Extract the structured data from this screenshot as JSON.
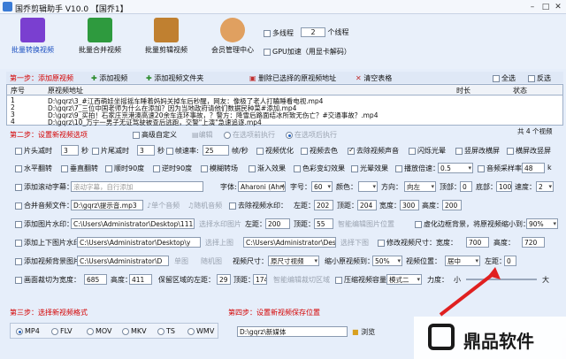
{
  "window": {
    "title": "国乔剪辑助手 V10.0  【国乔1】"
  },
  "toolbar": {
    "tools": [
      {
        "label": "批量转换视频"
      },
      {
        "label": "批量合并视频"
      },
      {
        "label": "批量剪辑视频"
      },
      {
        "label": "会员管理中心"
      }
    ],
    "multithread_label": "多线程",
    "thread_count": "2",
    "thread_suffix": "个线程",
    "gpu_label": "GPU加速（用显卡解码）"
  },
  "step1": {
    "title": "第一步：添加原视频",
    "add_video": "添加视频",
    "add_folder": "添加视频文件夹",
    "remove": "删除已选择的原视频地址",
    "clear": "清空表格",
    "select_all": "全选",
    "invert": "反选"
  },
  "list": {
    "headers": [
      "序号",
      "原视频地址",
      "时长",
      "状态"
    ],
    "rows": [
      {
        "no": "1",
        "path": "D:\\gqrz\\3_#江西萌娃坐摇摇车睡着妈妈关掉车后秒醒，网友：像极了老人打瞌睡看电视.mp4"
      },
      {
        "no": "2",
        "path": "D:\\gqrz\\7_三位中国老师为什么在添加？因为当地政府请他们数据民种菜#添加.mp4"
      },
      {
        "no": "3",
        "path": "D:\\gqrz\\9_买拍！石家庄京港澳高速20余车连环事故，？警方：降雪后路面结冰所致无伤亡？#交通事故？.mp4"
      },
      {
        "no": "4",
        "path": "D:\\gqrz\\10_万宁一男子无证驾驶被查后逃跑，交警\"上演\"急速追逐.mp4"
      }
    ],
    "count": "共 4 个视频"
  },
  "step2": {
    "title": "第二步：设置新视频选项",
    "advanced": "高级自定义",
    "edit": "编辑",
    "before": "在选项前执行",
    "after": "在选项后执行",
    "r1": {
      "head_cut": "片头减时",
      "head_val": "3",
      "sec1": "秒",
      "tail_cut": "片尾减时",
      "tail_val": "3",
      "sec2": "秒",
      "fps": "帧速率:",
      "fps_val": "25",
      "fps_unit": "帧/秒",
      "optimize": "视频优化",
      "decolor": "视频去色",
      "remove_audio": "去除视频声音",
      "flash": "闪烁光晕",
      "v_to_h": "竖屏改横屏",
      "h_to_v": "横屏改竖屏"
    },
    "r2": {
      "hflip": "水平翻转",
      "vflip": "垂直翻转",
      "rot90": "顺时90度",
      "rot_neg90": "逆时90度",
      "blur_transition": "模糊转场",
      "fade": "渐入效果",
      "color_diff": "色彩变幻效果",
      "light": "光晕效果",
      "speed": "播放倍速：",
      "speed_val": "0.5",
      "sample": "音频采样率：",
      "sample_val": "48",
      "k": "k"
    },
    "r3": {
      "scroll": "添加滚动字幕：",
      "scroll_ph": "滚动字幕，自行添加",
      "font": "字体:",
      "font_val": "Aharoni (Ahr)",
      "size": "字号：",
      "size_val": "60",
      "color": "颜色：",
      "dir": "方向：",
      "dir_val": "向左",
      "top": "顶部：",
      "top_val": "0",
      "bottom": "底部：",
      "bottom_val": "100",
      "speed": "速度：",
      "speed_val": "2"
    },
    "r4": {
      "merge": "合并音频文件：",
      "merge_path": "D:\\gqrz\\提示音.mp3",
      "single": "单个音频",
      "random": "随机音频",
      "remove_wm": "去除视频水印：",
      "left": "左距：",
      "left_val": "202",
      "top": "顶距：",
      "top_val": "204",
      "w": "宽度：",
      "w_val": "300",
      "h": "高度：",
      "h_val": "200"
    },
    "r5": {
      "add_img_wm": "添加图片水印：",
      "img_path": "C:\\Users\\Administrator\\Desktop\\111.j",
      "pick_wm": "选择水印图片",
      "left": "左距：",
      "left_val": "200",
      "top": "顶距：",
      "top_val": "55",
      "smart": "智能编辑图片位置",
      "blur_bg": "虚化边框背景，将原视频缩小到：",
      "blur_val": "90%"
    },
    "r6": {
      "add_tb": "添加上下图片水印：",
      "tb_path": "C:\\Users\\Administrator\\Desktop\\y",
      "pick_top": "选择上图",
      "bottom_path": "C:\\Users\\Administrator\\Desk",
      "pick_bottom": "选择下图",
      "resize": "修改视频尺寸：",
      "w": "宽度：",
      "w_val": "700",
      "h": "高度：",
      "h_val": "720"
    },
    "r7": {
      "add_bg": "添加视频背景图片：",
      "bg_path": "C:\\Users\\Administrator\\D",
      "single": "单图",
      "random": "随机图",
      "video_size": "视频尺寸：",
      "video_size_val": "原尺寸视频",
      "scale": "缩小原视频到：",
      "scale_val": "50%",
      "pos": "视频位置：",
      "pos_val": "居中",
      "left": "左距：",
      "left_val": "0"
    },
    "r8": {
      "crop": "画面裁切为宽度：",
      "crop_w": "685",
      "h": "高度：",
      "h_val": "411",
      "keep": "保留区域的左距：",
      "keep_val": "29",
      "top": "顶距：",
      "top_val": "174",
      "smart": "智能编辑裁切区域",
      "compress": "压缩视频容量",
      "mode": "模式二",
      "strength": "力度：",
      "small": "小",
      "big": "大"
    }
  },
  "step3": {
    "title": "第三步：选择新视频格式",
    "formats": [
      "MP4",
      "FLV",
      "MOV",
      "MKV",
      "TS",
      "WMV"
    ]
  },
  "step4": {
    "title": "第四步：设置新视频保存位置",
    "path": "D:\\gqrz\\新媒体",
    "browse": "浏览"
  },
  "watermark": {
    "text": "鼎品软件"
  },
  "colors": {
    "accent": "#d40000",
    "bg": "#e6eefa"
  }
}
